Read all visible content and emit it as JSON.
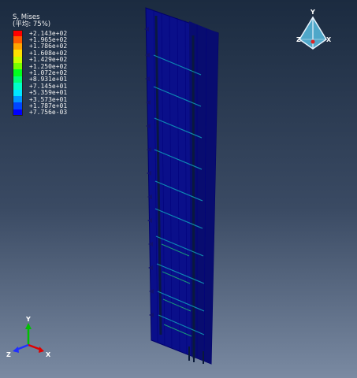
{
  "legend": {
    "title": "S, Mises",
    "subtitle": "(平均: 75%)",
    "levels": [
      {
        "value": "+2.143e+02",
        "color": "#ff0000"
      },
      {
        "value": "+1.965e+02",
        "color": "#ff5a00"
      },
      {
        "value": "+1.786e+02",
        "color": "#ffa500"
      },
      {
        "value": "+1.608e+02",
        "color": "#ffe100"
      },
      {
        "value": "+1.429e+02",
        "color": "#c8ff00"
      },
      {
        "value": "+1.250e+02",
        "color": "#78ff00"
      },
      {
        "value": "+1.072e+02",
        "color": "#00ff1e"
      },
      {
        "value": "+8.931e+01",
        "color": "#00ff78"
      },
      {
        "value": "+7.145e+01",
        "color": "#00ffc8"
      },
      {
        "value": "+5.359e+01",
        "color": "#00e6ff"
      },
      {
        "value": "+3.573e+01",
        "color": "#0096ff"
      },
      {
        "value": "+1.787e+01",
        "color": "#0046ff"
      },
      {
        "value": "+7.756e-03",
        "color": "#0000ff"
      }
    ]
  },
  "view_cube": {
    "y_label": "Y",
    "z_label": "Z",
    "x_label": "X"
  },
  "triad": {
    "y_label": "Y",
    "z_label": "Z",
    "x_label": "X",
    "y_color": "#00c000",
    "x_color": "#e00000",
    "z_color": "#2030ff"
  }
}
